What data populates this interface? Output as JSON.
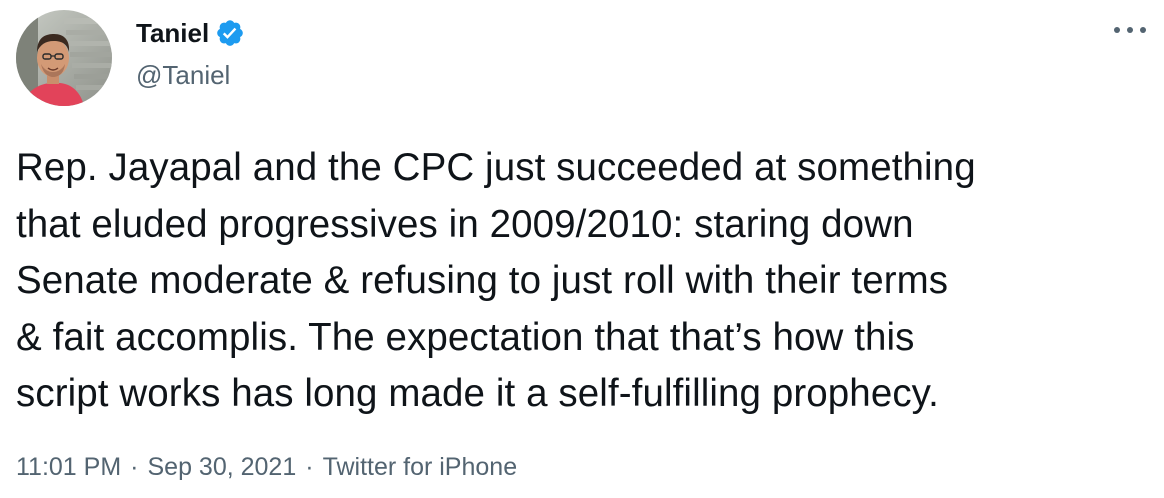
{
  "author": {
    "display_name": "Taniel",
    "handle": "@Taniel",
    "verified": true,
    "avatar_icon": "profile-photo"
  },
  "menu": {
    "icon": "more-horizontal-icon"
  },
  "tweet": {
    "lines": [
      "Rep. Jayapal and the CPC just succeeded at something",
      "that eluded progressives in 2009/2010: staring down",
      "Senate moderate & refusing to just roll with their terms",
      "& fait accomplis. The expectation that that’s how this",
      "script works has long made it a self-fulfilling prophecy."
    ]
  },
  "meta": {
    "time": "11:01 PM",
    "separator": "·",
    "date": "Sep 30, 2021",
    "source": "Twitter for iPhone"
  },
  "colors": {
    "text": "#0f1419",
    "secondary": "#536471",
    "verified": "#1d9bf0"
  }
}
